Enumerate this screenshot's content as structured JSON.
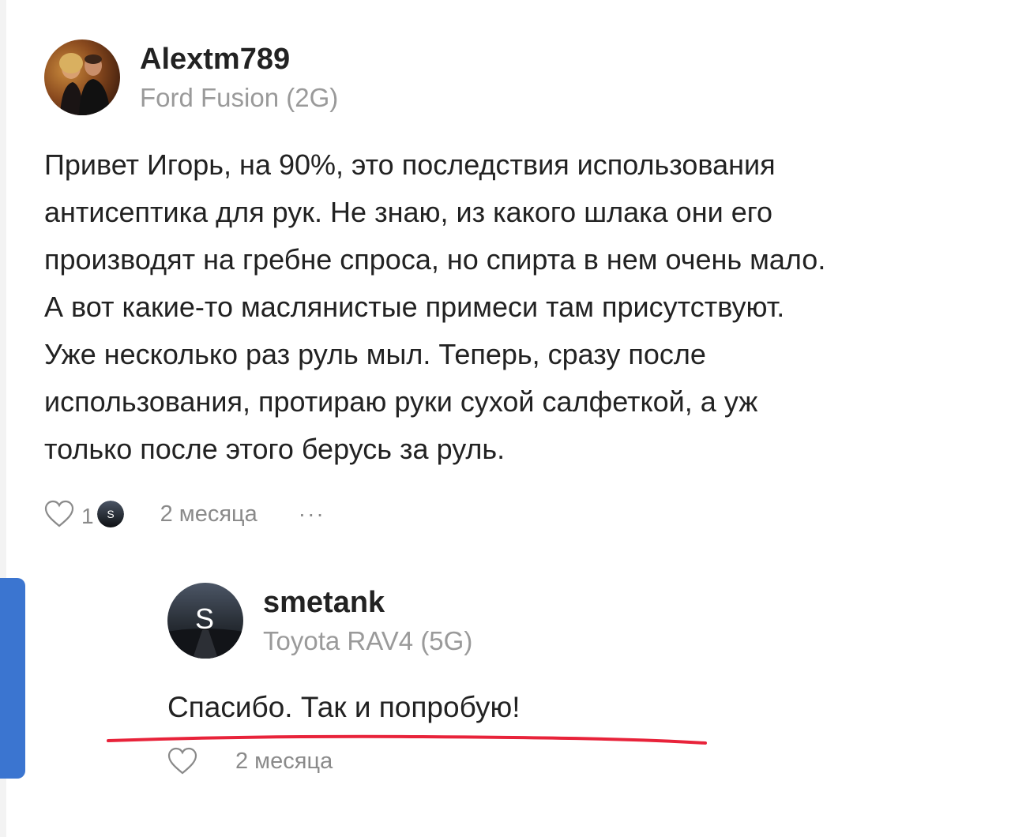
{
  "comment": {
    "author": "Alextm789",
    "car": "Ford Fusion (2G)",
    "text_lines": [
      "Привет Игорь, на 90%, это последствия использования",
      "антисептика для рук. Не знаю, из какого шлака они его",
      "производят на гребне спроса, но спирта в нем очень мало.",
      "А вот какие-то маслянистые примеси там присутствуют.",
      "Уже несколько раз руль мыл. Теперь, сразу после",
      "использования, протираю руки сухой салфеткой, а уж",
      "только после этого берусь за руль."
    ],
    "like_count": "1",
    "liker_initial": "S",
    "time": "2 месяца",
    "more": "···"
  },
  "reply": {
    "author": "smetank",
    "car": "Toyota RAV4 (5G)",
    "avatar_initial": "S",
    "text": "Спасибо. Так и попробую!",
    "time": "2 месяца"
  },
  "colors": {
    "accent_bar": "#3b75d0",
    "underline": "#e8233a",
    "muted_text": "#8a8a8a"
  }
}
